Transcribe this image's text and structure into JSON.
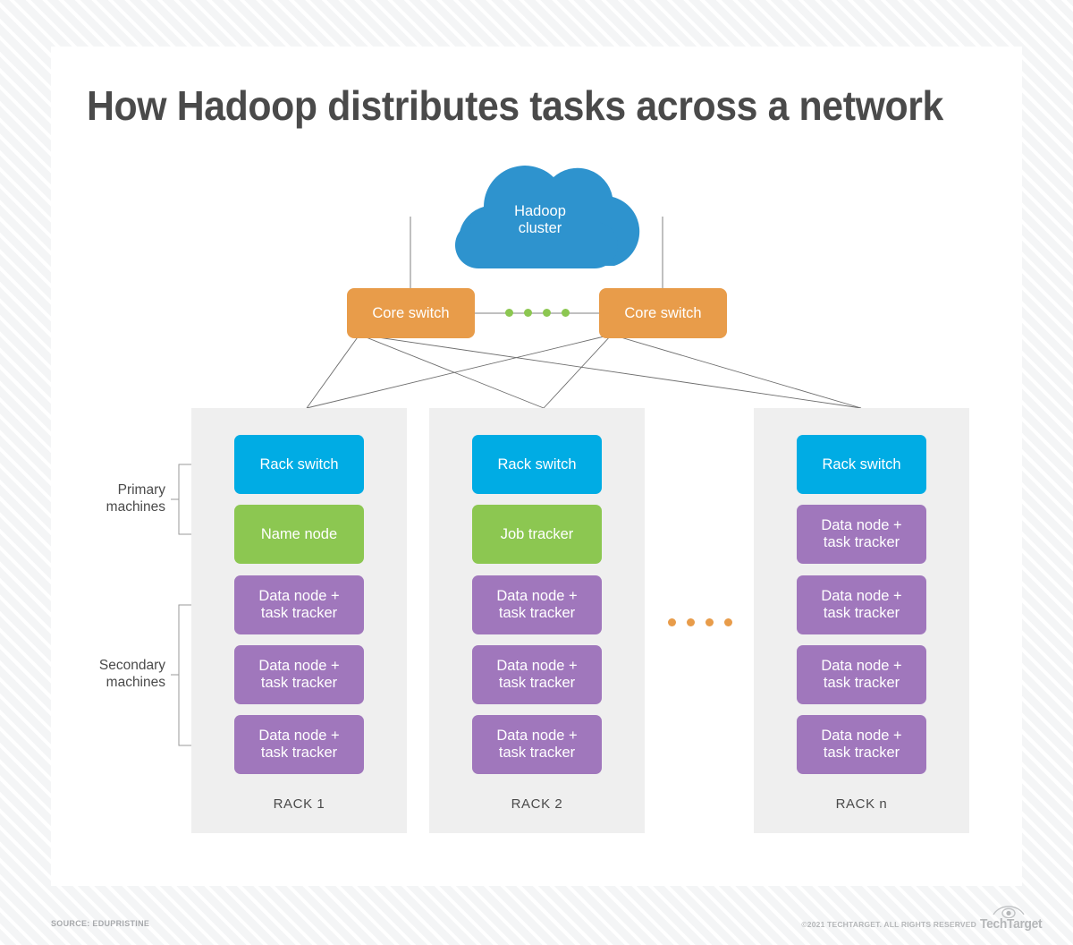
{
  "page": {
    "title": "How Hadoop distributes tasks across a network"
  },
  "colors": {
    "core_switch": "#e89c4a",
    "rack_switch": "#00ace4",
    "primary_node": "#8cc751",
    "data_node": "#a077bc",
    "cloud": "#2e93ce",
    "rack_panel": "#efefef",
    "connector_line": "#808080",
    "title_text": "#4a4a4a"
  },
  "diagram": {
    "cloud": {
      "label_line1": "Hadoop",
      "label_line2": "cluster"
    },
    "core_switches": [
      {
        "label": "Core switch"
      },
      {
        "label": "Core switch"
      }
    ],
    "core_switch_ellipsis": {
      "dot_count": 4,
      "color": "#8cc751"
    },
    "rack_ellipsis": {
      "dot_count": 4,
      "color": "#e89c4a"
    },
    "bracket_labels": [
      {
        "line1": "Primary",
        "line2": "machines"
      },
      {
        "line1": "Secondary",
        "line2": "machines"
      }
    ],
    "racks": [
      {
        "caption": "RACK 1",
        "nodes": [
          {
            "label_line1": "Rack switch",
            "label_line2": "",
            "type": "switch"
          },
          {
            "label_line1": "Name node",
            "label_line2": "",
            "type": "green"
          },
          {
            "label_line1": "Data node +",
            "label_line2": "task tracker",
            "type": "purple"
          },
          {
            "label_line1": "Data node +",
            "label_line2": "task tracker",
            "type": "purple"
          },
          {
            "label_line1": "Data node +",
            "label_line2": "task tracker",
            "type": "purple"
          }
        ]
      },
      {
        "caption": "RACK 2",
        "nodes": [
          {
            "label_line1": "Rack switch",
            "label_line2": "",
            "type": "switch"
          },
          {
            "label_line1": "Job tracker",
            "label_line2": "",
            "type": "green"
          },
          {
            "label_line1": "Data node +",
            "label_line2": "task tracker",
            "type": "purple"
          },
          {
            "label_line1": "Data node +",
            "label_line2": "task tracker",
            "type": "purple"
          },
          {
            "label_line1": "Data node +",
            "label_line2": "task tracker",
            "type": "purple"
          }
        ]
      },
      {
        "caption": "RACK n",
        "nodes": [
          {
            "label_line1": "Rack switch",
            "label_line2": "",
            "type": "switch"
          },
          {
            "label_line1": "Data node +",
            "label_line2": "task tracker",
            "type": "purple"
          },
          {
            "label_line1": "Data node +",
            "label_line2": "task tracker",
            "type": "purple"
          },
          {
            "label_line1": "Data node +",
            "label_line2": "task tracker",
            "type": "purple"
          },
          {
            "label_line1": "Data node +",
            "label_line2": "task tracker",
            "type": "purple"
          }
        ]
      }
    ]
  },
  "footer": {
    "source": "SOURCE: EDUPRISTINE",
    "rights": "©2021 TECHTARGET. ALL RIGHTS RESERVED",
    "logo_wordmark": "TechTarget"
  }
}
